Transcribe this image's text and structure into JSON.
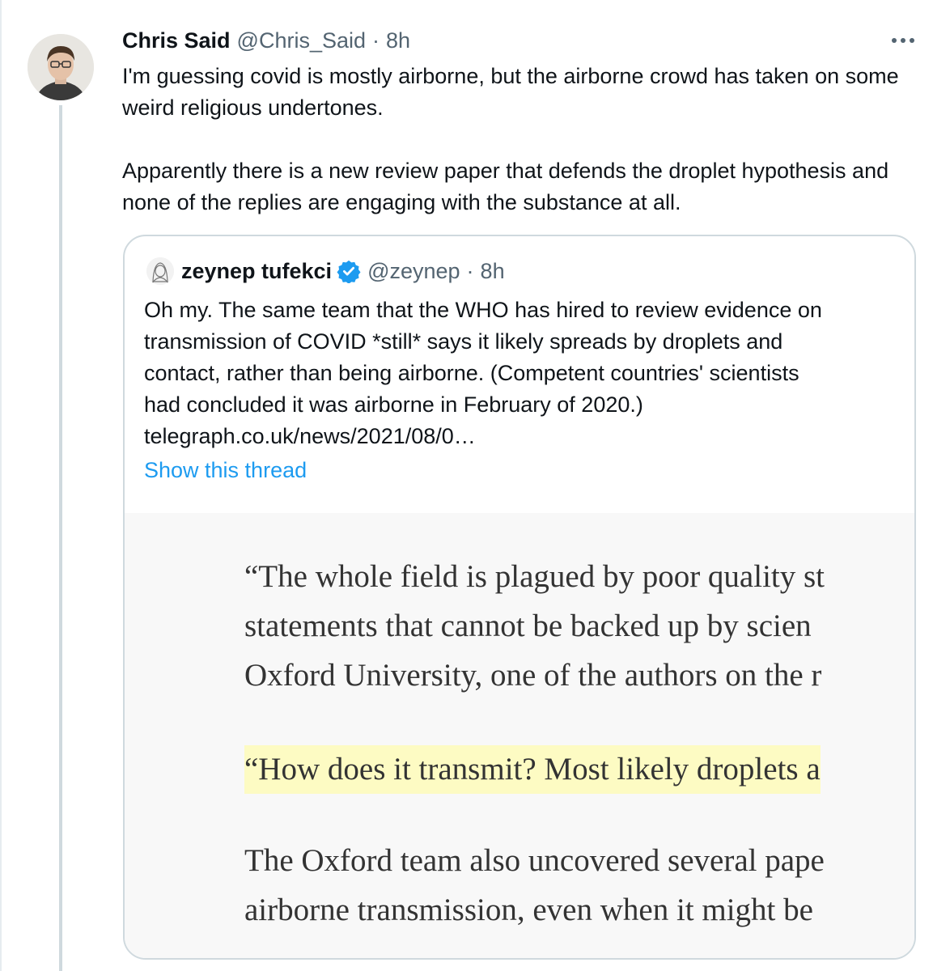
{
  "tweet": {
    "display_name": "Chris Said",
    "handle": "@Chris_Said",
    "separator": "·",
    "time": "8h",
    "paragraphs": [
      "I'm guessing covid is mostly airborne, but the airborne crowd has taken on some weird religious undertones.",
      "Apparently there is a new review paper that defends the droplet hypothesis and none of the replies are engaging with the substance at all."
    ]
  },
  "quote": {
    "display_name": "zeynep tufekci",
    "handle": "@zeynep",
    "separator": "·",
    "time": "8h",
    "lines": [
      "Oh my. The same team that the WHO has hired to review evidence on",
      "transmission of COVID *still* says it likely spreads by droplets and",
      "contact, rather than being airborne. (Competent countries' scientists",
      "had concluded it was airborne in February of 2020.)",
      "telegraph.co.uk/news/2021/08/0…"
    ],
    "show_thread": "Show this thread",
    "article_lines": [
      "“The whole field is plagued by poor quality st",
      "statements that cannot be backed up by scien",
      "Oxford University, one of the authors on the r",
      "“How does it transmit? Most likely droplets a",
      "The Oxford team also uncovered several pape",
      "airborne transmission, even when it might be"
    ]
  },
  "icons": {
    "more": "more-horizontal-icon",
    "verified": "verified-badge-icon"
  },
  "colors": {
    "link": "#1d9bf0",
    "secondary_text": "#536471",
    "highlight": "#fdfbc3",
    "border": "#cfd9de"
  }
}
